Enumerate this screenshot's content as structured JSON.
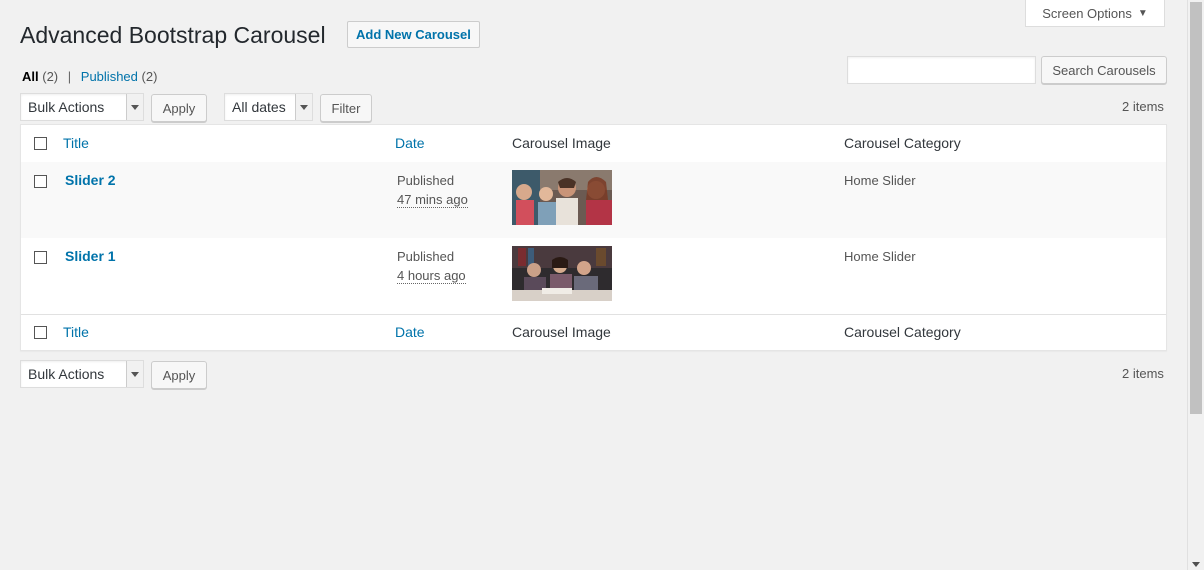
{
  "screen_options": {
    "label": "Screen Options",
    "icon": "triangle-down-icon"
  },
  "page": {
    "title": "Advanced Bootstrap Carousel",
    "add_new_label": "Add New Carousel"
  },
  "filters": {
    "all_label": "All",
    "all_count": "(2)",
    "separator": "|",
    "published_label": "Published",
    "published_count": "(2)"
  },
  "search": {
    "value": "",
    "button_label": "Search Carousels"
  },
  "top_nav": {
    "bulk_actions": "Bulk Actions",
    "apply_label": "Apply",
    "dates": "All dates",
    "filter_label": "Filter",
    "items_count": "2 items"
  },
  "bottom_nav": {
    "bulk_actions": "Bulk Actions",
    "apply_label": "Apply",
    "items_count": "2 items"
  },
  "table": {
    "columns": [
      "Title",
      "Date",
      "Carousel Image",
      "Carousel Category"
    ],
    "rows": [
      {
        "title": "Slider 2",
        "status": "Published",
        "time": "47 mins ago",
        "image": "group-of-students-photo",
        "category": "Home Slider"
      },
      {
        "title": "Slider 1",
        "status": "Published",
        "time": "4 hours ago",
        "image": "students-studying-photo",
        "category": "Home Slider"
      }
    ]
  },
  "colors": {
    "link": "#0073aa",
    "background": "#f1f1f1",
    "text": "#23282d"
  }
}
